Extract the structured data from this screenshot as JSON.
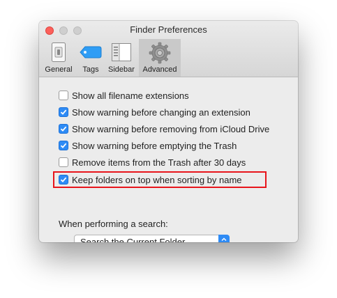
{
  "window": {
    "title": "Finder Preferences"
  },
  "tabs": [
    {
      "label": "General",
      "icon": "general-icon"
    },
    {
      "label": "Tags",
      "icon": "tag-icon"
    },
    {
      "label": "Sidebar",
      "icon": "sidebar-icon"
    },
    {
      "label": "Advanced",
      "icon": "gear-icon",
      "selected": true
    }
  ],
  "options": [
    {
      "label": "Show all filename extensions",
      "checked": false
    },
    {
      "label": "Show warning before changing an extension",
      "checked": true
    },
    {
      "label": "Show warning before removing from iCloud Drive",
      "checked": true
    },
    {
      "label": "Show warning before emptying the Trash",
      "checked": true
    },
    {
      "label": "Remove items from the Trash after 30 days",
      "checked": false
    },
    {
      "label": "Keep folders on top when sorting by name",
      "checked": true
    }
  ],
  "search": {
    "label": "When performing a search:",
    "selected": "Search the Current Folder"
  },
  "colors": {
    "accent": "#2e8bf5",
    "highlight": "#e8141b",
    "close": "#fc605b"
  }
}
